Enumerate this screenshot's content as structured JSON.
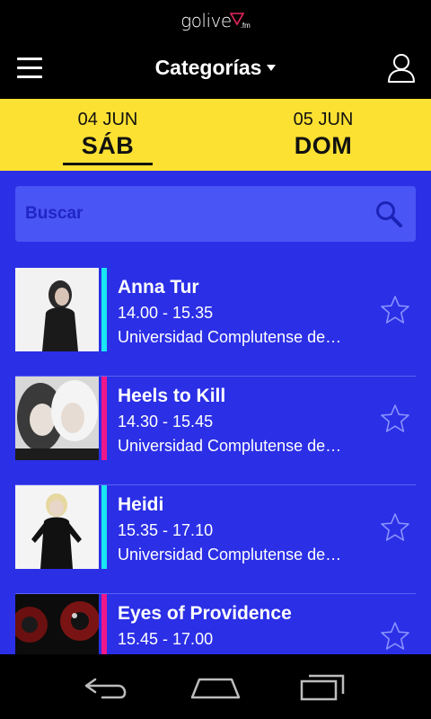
{
  "app": {
    "logo_text": "golive",
    "logo_suffix": ".fm"
  },
  "header": {
    "title": "Categorías"
  },
  "date_tabs": [
    {
      "date": "04 JUN",
      "day": "SÁB",
      "active": true
    },
    {
      "date": "05 JUN",
      "day": "DOM",
      "active": false
    }
  ],
  "search": {
    "placeholder": "Buscar"
  },
  "events": [
    {
      "name": "Anna Tur",
      "time": "14.00 - 15.35",
      "venue": "Universidad Complutense de…",
      "accent": "#19e6f2"
    },
    {
      "name": "Heels to Kill",
      "time": "14.30 - 15.45",
      "venue": "Universidad Complutense de…",
      "accent": "#f0178a"
    },
    {
      "name": "Heidi",
      "time": "15.35 - 17.10",
      "venue": "Universidad Complutense de…",
      "accent": "#19e6f2"
    },
    {
      "name": "Eyes of Providence",
      "time": "15.45 - 17.00",
      "venue": "",
      "accent": "#f0178a"
    }
  ],
  "colors": {
    "header_bg": "#000000",
    "tab_bg": "#fde132",
    "main_bg": "#2b2fe6",
    "search_bg": "#4a55f5"
  },
  "icons": [
    "hamburger-menu-icon",
    "user-icon",
    "search-icon",
    "star-outline-icon",
    "back-icon",
    "home-icon",
    "recent-apps-icon"
  ]
}
